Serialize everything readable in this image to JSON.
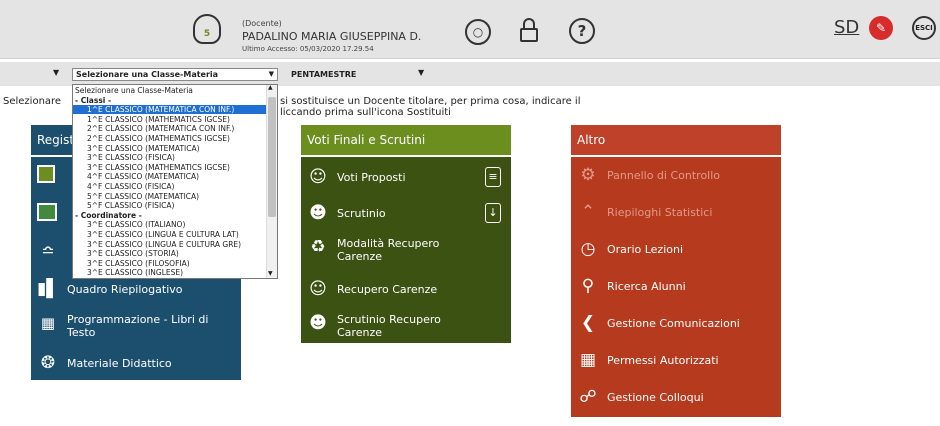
{
  "header": {
    "role": "(Docente)",
    "name": "PADALINO MARIA GIUSEPPINA D.",
    "last_access": "Ultimo Accesso: 05/03/2020 17.29.54",
    "avatar_badge": "5",
    "right_logo": "SD",
    "exit_label": "ESCI"
  },
  "toolbar": {
    "select_label": "Selezionare una Classe-Materia",
    "period": "PENTAMESTRE"
  },
  "sentence": {
    "prefix": "Selezionare",
    "line1": "si sostituisce un Docente titolare, per prima cosa, indicare il",
    "line2": "liccando prima sull'icona Sostituiti"
  },
  "dropdown": {
    "options": [
      {
        "label": "Selezionare una Classe-Materia",
        "kind": "option"
      },
      {
        "label": "- Classi -",
        "kind": "group"
      },
      {
        "label": "1^E CLASSICO (MATEMATICA CON INF.)",
        "kind": "selected"
      },
      {
        "label": "1^E CLASSICO (MATHEMATICS IGCSE)",
        "kind": "option"
      },
      {
        "label": "2^E CLASSICO (MATEMATICA CON INF.)",
        "kind": "option"
      },
      {
        "label": "2^E CLASSICO (MATHEMATICS IGCSE)",
        "kind": "option"
      },
      {
        "label": "3^E CLASSICO (MATEMATICA)",
        "kind": "option"
      },
      {
        "label": "3^E CLASSICO (FISICA)",
        "kind": "option"
      },
      {
        "label": "3^E CLASSICO (MATHEMATICS IGCSE)",
        "kind": "option"
      },
      {
        "label": "4^F CLASSICO (MATEMATICA)",
        "kind": "option"
      },
      {
        "label": "4^F CLASSICO (FISICA)",
        "kind": "option"
      },
      {
        "label": "5^F CLASSICO (MATEMATICA)",
        "kind": "option"
      },
      {
        "label": "5^F CLASSICO (FISICA)",
        "kind": "option"
      },
      {
        "label": "- Coordinatore -",
        "kind": "group"
      },
      {
        "label": "3^E CLASSICO (ITALIANO)",
        "kind": "option"
      },
      {
        "label": "3^E CLASSICO (LINGUA E CULTURA LAT)",
        "kind": "option"
      },
      {
        "label": "3^E CLASSICO (LINGUA E CULTURA GRE)",
        "kind": "option"
      },
      {
        "label": "3^E CLASSICO (STORIA)",
        "kind": "option"
      },
      {
        "label": "3^E CLASSICO (FILOSOFIA)",
        "kind": "option"
      },
      {
        "label": "3^E CLASSICO (INGLESE)",
        "kind": "option"
      }
    ]
  },
  "registro": {
    "title": "Registr",
    "color": "#1c4f6e",
    "items": [
      "Quadro Riepilogativo",
      "Programmazione - Libri di Testo",
      "Materiale Didattico"
    ]
  },
  "voti": {
    "title": "Voti Finali e Scrutini",
    "head_color": "#6b8e1f",
    "body_color": "#3c5213",
    "items": [
      "Voti Proposti",
      "Scrutinio",
      "Modalità Recupero Carenze",
      "Recupero Carenze",
      "Scrutinio Recupero Carenze"
    ]
  },
  "altro": {
    "title": "Altro",
    "head_color": "#c0412a",
    "body_color": "#b53a1e",
    "items": [
      "Pannello di Controllo",
      "Riepiloghi Statistici",
      "Orario Lezioni",
      "Ricerca Alunni",
      "Gestione Comunicazioni",
      "Permessi Autorizzati",
      "Gestione Colloqui"
    ]
  }
}
